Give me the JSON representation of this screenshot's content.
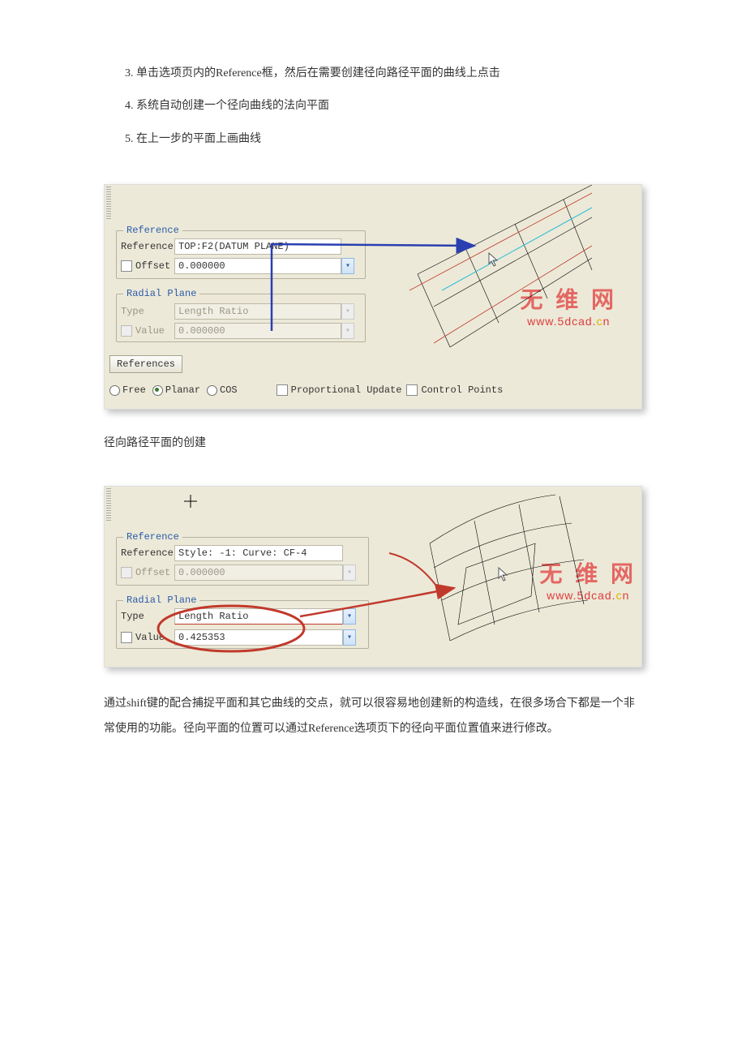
{
  "steps": {
    "start": 3,
    "items": [
      "单击选项页内的Reference框，然后在需要创建径向路径平面的曲线上点击",
      "系统自动创建一个径向曲线的法向平面",
      "在上一步的平面上画曲线"
    ]
  },
  "fig1": {
    "group_reference": "Reference",
    "reference_label": "Reference",
    "reference_value": "TOP:F2(DATUM PLANE)",
    "offset_label": "Offset",
    "offset_value": "0.000000",
    "group_radial": "Radial Plane",
    "type_label": "Type",
    "type_value": "Length Ratio",
    "value_label": "Value",
    "value_value": "0.000000",
    "references_btn": "References",
    "radio_free": "Free",
    "radio_planar": "Planar",
    "radio_cos": "COS",
    "cb_proportional": "Proportional Update",
    "cb_control": "Control Points"
  },
  "caption1": "径向路径平面的创建",
  "fig2": {
    "group_reference": "Reference",
    "reference_label": "Reference",
    "reference_value": "Style: -1: Curve:   CF-4",
    "offset_label": "Offset",
    "offset_value": "0.000000",
    "group_radial": "Radial Plane",
    "type_label": "Type",
    "type_value": "Length Ratio",
    "value_label": "Value",
    "value_value": "0.425353"
  },
  "paragraph": "通过shift键的配合捕捉平面和其它曲线的交点，就可以很容易地创建新的构造线，在很多场合下都是一个非常使用的功能。径向平面的位置可以通过Reference选项页下的径向平面位置值来进行修改。",
  "watermark_cn": "无 维 网",
  "watermark_en_pre": "www.5dcad.",
  "watermark_en_y": "c",
  "watermark_en_post": "n"
}
